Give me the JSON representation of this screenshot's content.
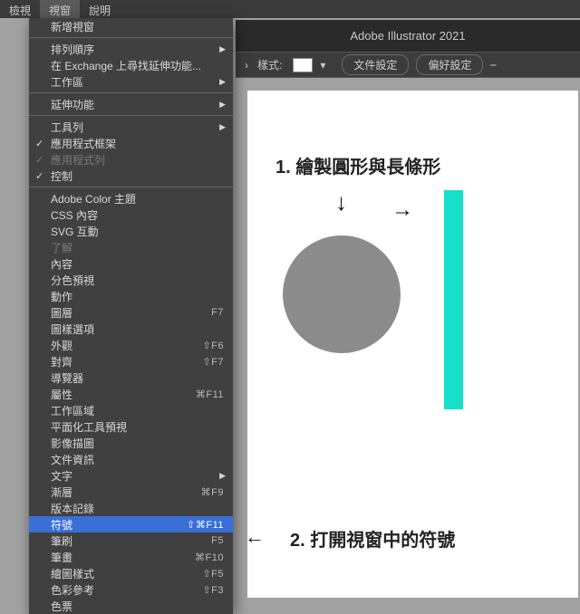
{
  "menubar": {
    "items": [
      "檢視",
      "視窗",
      "說明"
    ],
    "active_index": 1
  },
  "titlebar": "Adobe Illustrator 2021",
  "toolbar": {
    "style_label": "樣式:",
    "doc_settings_label": "文件設定",
    "prefs_label": "偏好設定"
  },
  "dropdown": [
    {
      "type": "item",
      "label": "新增視窗"
    },
    {
      "type": "sep"
    },
    {
      "type": "item",
      "label": "排列順序",
      "submenu": true
    },
    {
      "type": "item",
      "label": "在 Exchange 上尋找延伸功能..."
    },
    {
      "type": "item",
      "label": "工作區",
      "submenu": true
    },
    {
      "type": "sep"
    },
    {
      "type": "item",
      "label": "延伸功能",
      "submenu": true
    },
    {
      "type": "sep"
    },
    {
      "type": "item",
      "label": "工具列",
      "submenu": true
    },
    {
      "type": "item",
      "label": "應用程式框架",
      "check": true
    },
    {
      "type": "item",
      "label": "應用程式列",
      "check": true,
      "disabled": true
    },
    {
      "type": "item",
      "label": "控制",
      "check": true
    },
    {
      "type": "sep"
    },
    {
      "type": "item",
      "label": "Adobe Color 主題"
    },
    {
      "type": "item",
      "label": "CSS 內容"
    },
    {
      "type": "item",
      "label": "SVG 互動"
    },
    {
      "type": "item",
      "label": "了解",
      "disabled": true
    },
    {
      "type": "item",
      "label": "內容"
    },
    {
      "type": "item",
      "label": "分色預視"
    },
    {
      "type": "item",
      "label": "動作"
    },
    {
      "type": "item",
      "label": "圖層",
      "shortcut": "F7"
    },
    {
      "type": "item",
      "label": "圖樣選項"
    },
    {
      "type": "item",
      "label": "外觀",
      "shortcut": "⇧F6"
    },
    {
      "type": "item",
      "label": "對齊",
      "shortcut": "⇧F7"
    },
    {
      "type": "item",
      "label": "導覽器"
    },
    {
      "type": "item",
      "label": "屬性",
      "shortcut": "⌘F11"
    },
    {
      "type": "item",
      "label": "工作區域"
    },
    {
      "type": "item",
      "label": "平面化工具預視"
    },
    {
      "type": "item",
      "label": "影像描圖"
    },
    {
      "type": "item",
      "label": "文件資訊"
    },
    {
      "type": "item",
      "label": "文字",
      "submenu": true
    },
    {
      "type": "item",
      "label": "漸層",
      "shortcut": "⌘F9"
    },
    {
      "type": "item",
      "label": "版本記錄"
    },
    {
      "type": "item",
      "label": "符號",
      "shortcut": "⇧⌘F11",
      "hl": true
    },
    {
      "type": "item",
      "label": "筆刷",
      "shortcut": "F5"
    },
    {
      "type": "item",
      "label": "筆畫",
      "shortcut": "⌘F10"
    },
    {
      "type": "item",
      "label": "繪圖樣式",
      "shortcut": "⇧F5"
    },
    {
      "type": "item",
      "label": "色彩參考",
      "shortcut": "⇧F3"
    },
    {
      "type": "item",
      "label": "色票"
    }
  ],
  "annotations": {
    "step1": "1. 繪製圓形與長條形",
    "step2": "2. 打開視窗中的符號"
  }
}
